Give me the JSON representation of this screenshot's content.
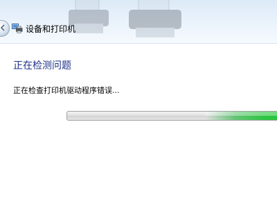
{
  "window": {
    "title": "设备和打印机"
  },
  "content": {
    "heading": "正在检测问题",
    "status_text": "正在检查打印机驱动程序错误..."
  },
  "progress": {
    "state": "indeterminate",
    "color": "#26c43a"
  },
  "icons": {
    "back": "back-arrow-icon",
    "app": "devices-printers-icon",
    "background": "printer-icon"
  },
  "colors": {
    "heading": "#1e3287",
    "titlebar": "#e6f0fa"
  }
}
